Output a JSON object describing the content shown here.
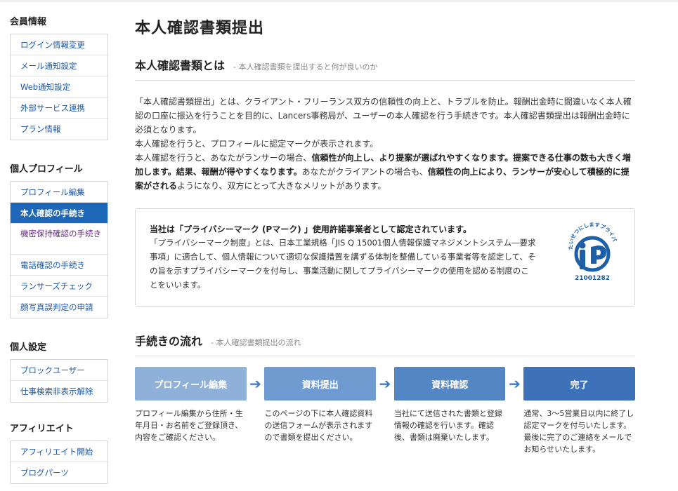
{
  "sidebar": {
    "sections": [
      {
        "title": "会員情報",
        "items": [
          "ログイン情報変更",
          "メール通知設定",
          "Web通知設定",
          "外部サービス連携",
          "プラン情報"
        ]
      },
      {
        "title": "個人プロフィール",
        "items": [
          "プロフィール編集",
          "本人確認の手続き",
          "機密保持確認の手続き",
          "電話確認の手続き",
          "ランサーズチェック",
          "顔写真誤判定の申請"
        ]
      },
      {
        "title": "個人設定",
        "items": [
          "ブロックユーザー",
          "仕事検索非表示解除"
        ]
      },
      {
        "title": "アフィリエイト",
        "items": [
          "アフィリエイト開始",
          "ブログパーツ"
        ]
      }
    ]
  },
  "main": {
    "title": "本人確認書類提出",
    "about": {
      "heading": "本人確認書類とは",
      "note": "- 本人確認書類を提出すると何が良いのか",
      "p1": "「本人確認書類提出」とは、クライアント・フリーランス双方の信頼性の向上と、トラブルを防止。報酬出金時に間違いなく本人確認の口座に振込を行うことを目的に、Lancers事務局が、ユーザーの本人確認を行う手続きです。本人確認書類提出は報酬出金時に必須となります。",
      "p2": "本人確認を行うと、プロフィールに認定マークが表示されます。",
      "p3a": "本人確認を行うと、あなたがランサーの場合、",
      "p3b": "信頼性が向上し、より提案が選ばれやすくなります。提案できる仕事の数も大きく増加します。結果、報酬が得やすくなります。",
      "p3c": "あなたがクライアントの場合も、",
      "p3d": "信頼性の向上により、ランサーが安心して積極的に提案がされる",
      "p3e": "ようになり、双方にとって大きなメリットがあります。"
    },
    "privacy": {
      "title": "当社は「プライバシーマーク (Pマーク) 」使用許諾事業者として認定されています。",
      "text": "「プライバシーマーク制度」とは、日本工業規格「JIS Q 15001個人情報保護マネジメントシステム―要求事項」に適合して、個人情報について適切な保護措置を講ずる体制を整備している事業者等を認定して、その旨を示すプライバシーマークを付与し、事業活動に関してプライバシーマークの使用を認める制度のことをいいます。",
      "mark_arc": "たいせつにしますプライバシー",
      "mark_number": "21001282"
    },
    "flow": {
      "heading": "手続きの流れ",
      "note": "- 本人確認書類提出の流れ",
      "steps": [
        {
          "label": "プロフィール編集",
          "color": "#8fb0d9",
          "text": "プロフィール編集から住所・生年月日・お名前をご登録頂き、内容をご確認ください。"
        },
        {
          "label": "資料提出",
          "color": "#6f9bd1",
          "text": "このページの下に本人確認資料の送信フォームが表示されますので書類を提出ください。"
        },
        {
          "label": "資料確認",
          "color": "#5586c4",
          "text": "当社にて送信された書類と登録情報の確認を行います。確認後、書類は廃棄いたします。"
        },
        {
          "label": "完了",
          "color": "#3d72b8",
          "text": "通常、3〜5営業日以内に終了し認定マークを付与いたします。最後に完了のご連絡をメールでお知らせいたします。"
        }
      ]
    }
  },
  "colors": {
    "active": "#1d66b8",
    "link": "#1b57a6",
    "arrow": "#3f7ac2",
    "pmark": "#1d5fa8"
  }
}
